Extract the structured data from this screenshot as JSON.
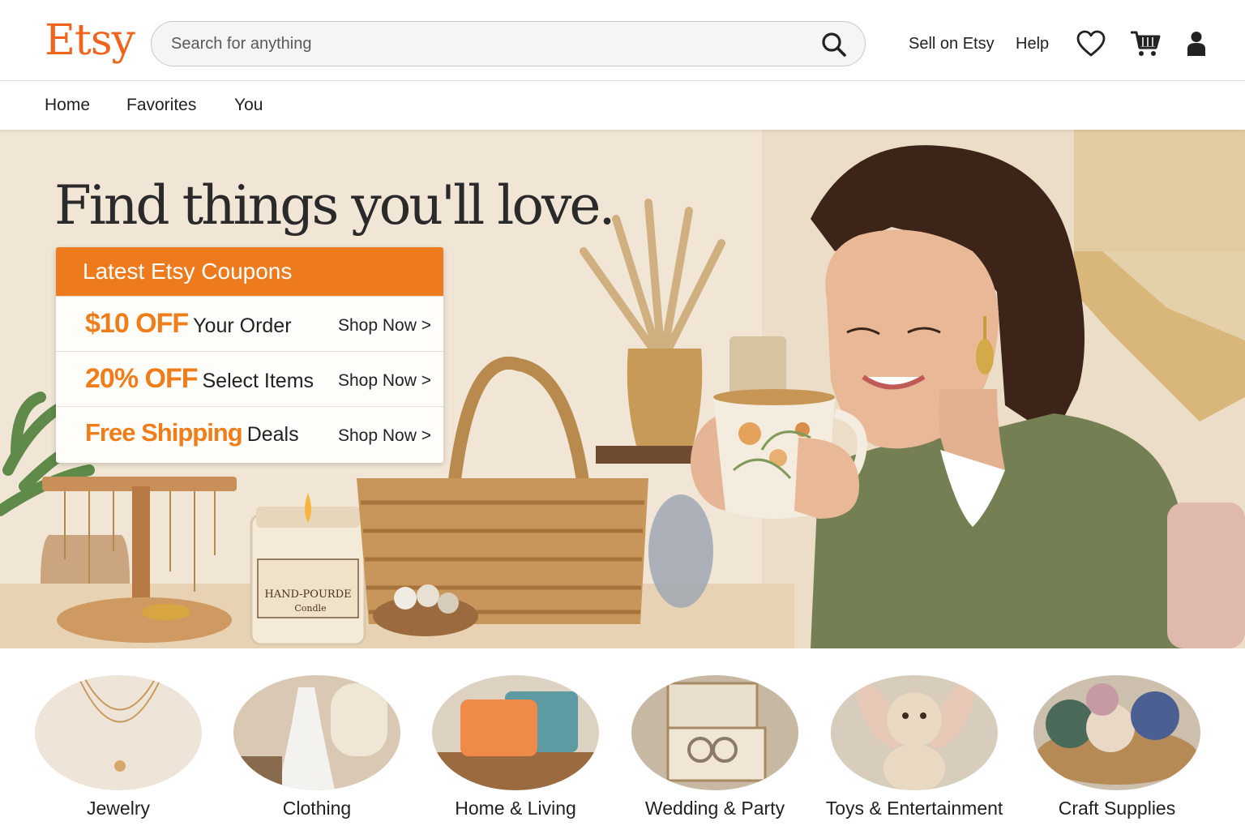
{
  "header": {
    "logo": "Etsy",
    "search_placeholder": "Search for anything",
    "sell_link": "Sell on Etsy",
    "help_link": "Help"
  },
  "nav": {
    "items": [
      "Home",
      "Favorites",
      "You"
    ]
  },
  "hero": {
    "title": "Find things you'll love.",
    "candle_label_line1": "HAND-POURDE",
    "candle_label_line2": "Condle"
  },
  "coupons": {
    "title": "Latest Etsy Coupons",
    "rows": [
      {
        "highlight": "$10 OFF",
        "text": "Your Order",
        "cta": "Shop Now >"
      },
      {
        "highlight": "20% OFF",
        "text": "Select Items",
        "cta": "Shop Now >"
      },
      {
        "highlight": "Free Shipping",
        "text": "Deals",
        "cta": "Shop Now >"
      }
    ]
  },
  "categories": [
    {
      "label": "Jewelry"
    },
    {
      "label": "Clothing"
    },
    {
      "label": "Home & Living"
    },
    {
      "label": "Wedding & Party"
    },
    {
      "label": "Toys & Entertainment"
    },
    {
      "label": "Craft Supplies"
    }
  ],
  "colors": {
    "brand": "#f1641e",
    "coupon_accent": "#ee7a1e"
  },
  "icons": [
    "search-icon",
    "heart-icon",
    "cart-icon",
    "user-icon"
  ]
}
